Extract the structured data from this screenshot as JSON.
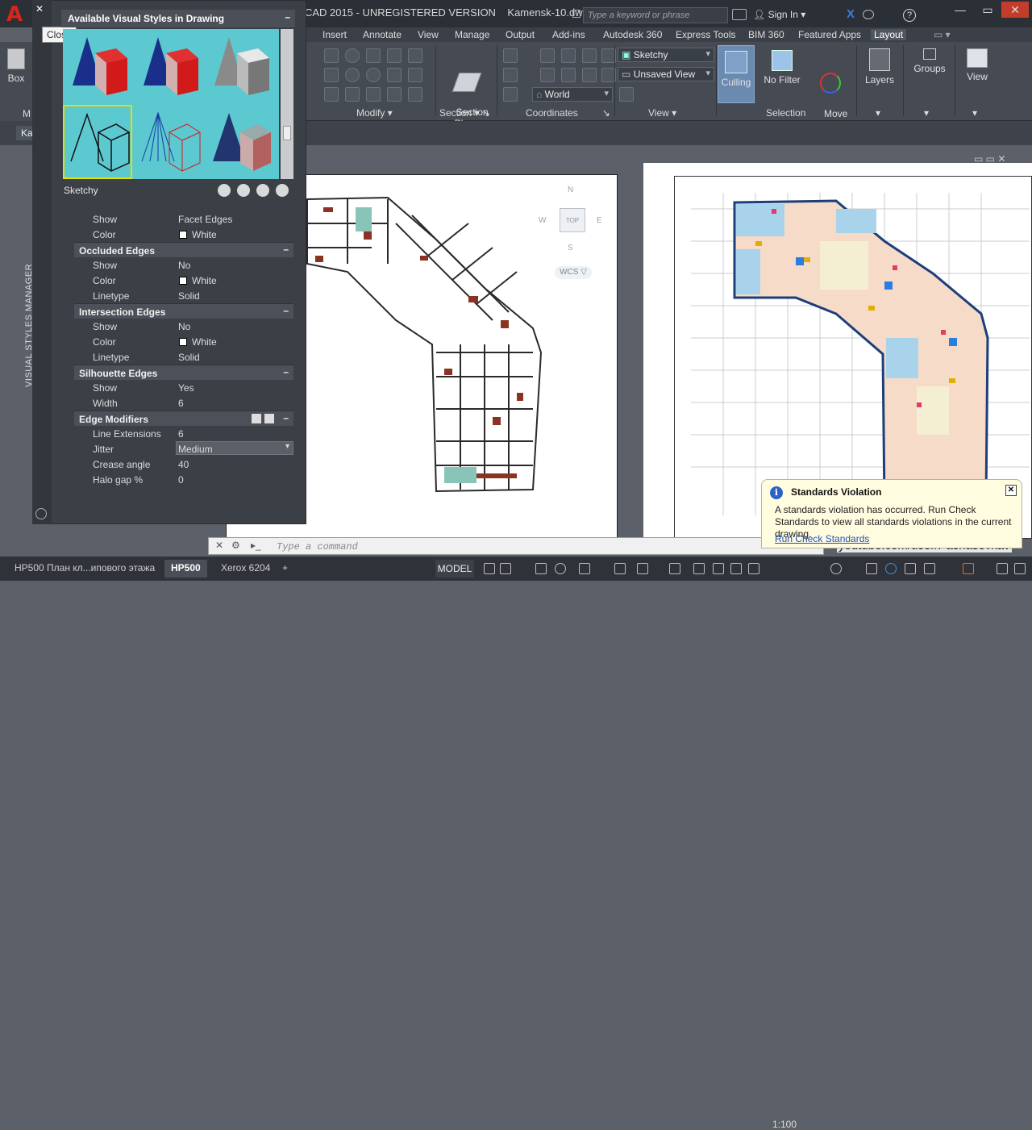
{
  "app": {
    "title_text": "CAD 2015 - UNREGISTERED VERSION",
    "file": "Kamensk-10.dwg",
    "search_placeholder": "Type a keyword or phrase",
    "sign_in": "Sign In"
  },
  "ribbon": {
    "tabs": [
      "Insert",
      "Annotate",
      "View",
      "Manage",
      "Output",
      "Add-ins",
      "Autodesk 360",
      "Express Tools",
      "BIM 360",
      "Featured Apps",
      "Layout"
    ],
    "active_tab": "Layout",
    "left_box_label": "Box",
    "left_panel_letter": "M",
    "section_plane": "Section\nPlane",
    "visual_style_combo": "Sketchy",
    "view_combo": "Unsaved View",
    "coords_combo": "World",
    "culling": "Culling",
    "no_filter": "No Filter",
    "move_gizmo": "Move\nGizmo",
    "layers": "Layers",
    "groups": "Groups",
    "view_btn": "View",
    "panel_labels": {
      "modify": "Modify",
      "section": "Section",
      "coordinates": "Coordinates",
      "view": "View",
      "selection": "Selection"
    }
  },
  "doc_tab_label": "Ka",
  "palette": {
    "vertical_title": "VISUAL STYLES MANAGER",
    "header": "Available Visual Styles in Drawing",
    "selected_style": "Sketchy",
    "close_tooltip": "Close",
    "rows": {
      "show1_k": "Show",
      "show1_v": "Facet Edges",
      "color1_k": "Color",
      "color1_v": "White",
      "occluded": "Occluded Edges",
      "show2_k": "Show",
      "show2_v": "No",
      "color2_k": "Color",
      "color2_v": "White",
      "lt2_k": "Linetype",
      "lt2_v": "Solid",
      "intersection": "Intersection Edges",
      "show3_k": "Show",
      "show3_v": "No",
      "color3_k": "Color",
      "color3_v": "White",
      "lt3_k": "Linetype",
      "lt3_v": "Solid",
      "silhouette": "Silhouette Edges",
      "show4_k": "Show",
      "show4_v": "Yes",
      "width_k": "Width",
      "width_v": "6",
      "modifiers": "Edge Modifiers",
      "lext_k": "Line Extensions",
      "lext_v": "6",
      "jitter_k": "Jitter",
      "jitter_v": "Medium",
      "crease_k": "Crease angle",
      "crease_v": "40",
      "halo_k": "Halo gap %",
      "halo_v": "0"
    }
  },
  "viewcube": {
    "n": "N",
    "s": "S",
    "e": "E",
    "w": "W",
    "top": "TOP",
    "wcs": "WCS"
  },
  "notification": {
    "title": "Standards Violation",
    "body": "A standards violation has occurred. Run Check Standards to view all standards violations in the current drawing.",
    "link": "Run Check Standards"
  },
  "command": {
    "placeholder": "Type  a  command"
  },
  "watermark": "youtube.com/user/Pashasevkav",
  "status": {
    "layout_tabs": [
      "HP500 План кл...ипового этажа",
      "HP500",
      "Xerox 6204"
    ],
    "active_layout": "HP500",
    "model": "MODEL",
    "scale": "1:100"
  },
  "colors": {
    "accent_red": "#d5261e",
    "ribbon_bg": "#454a53",
    "palette_bg": "#3b3f46",
    "swatch_bg": "#5cc8cf",
    "selection_outline": "#e6e000",
    "notif_bg": "#fffce0",
    "link_blue": "#2250c0"
  }
}
